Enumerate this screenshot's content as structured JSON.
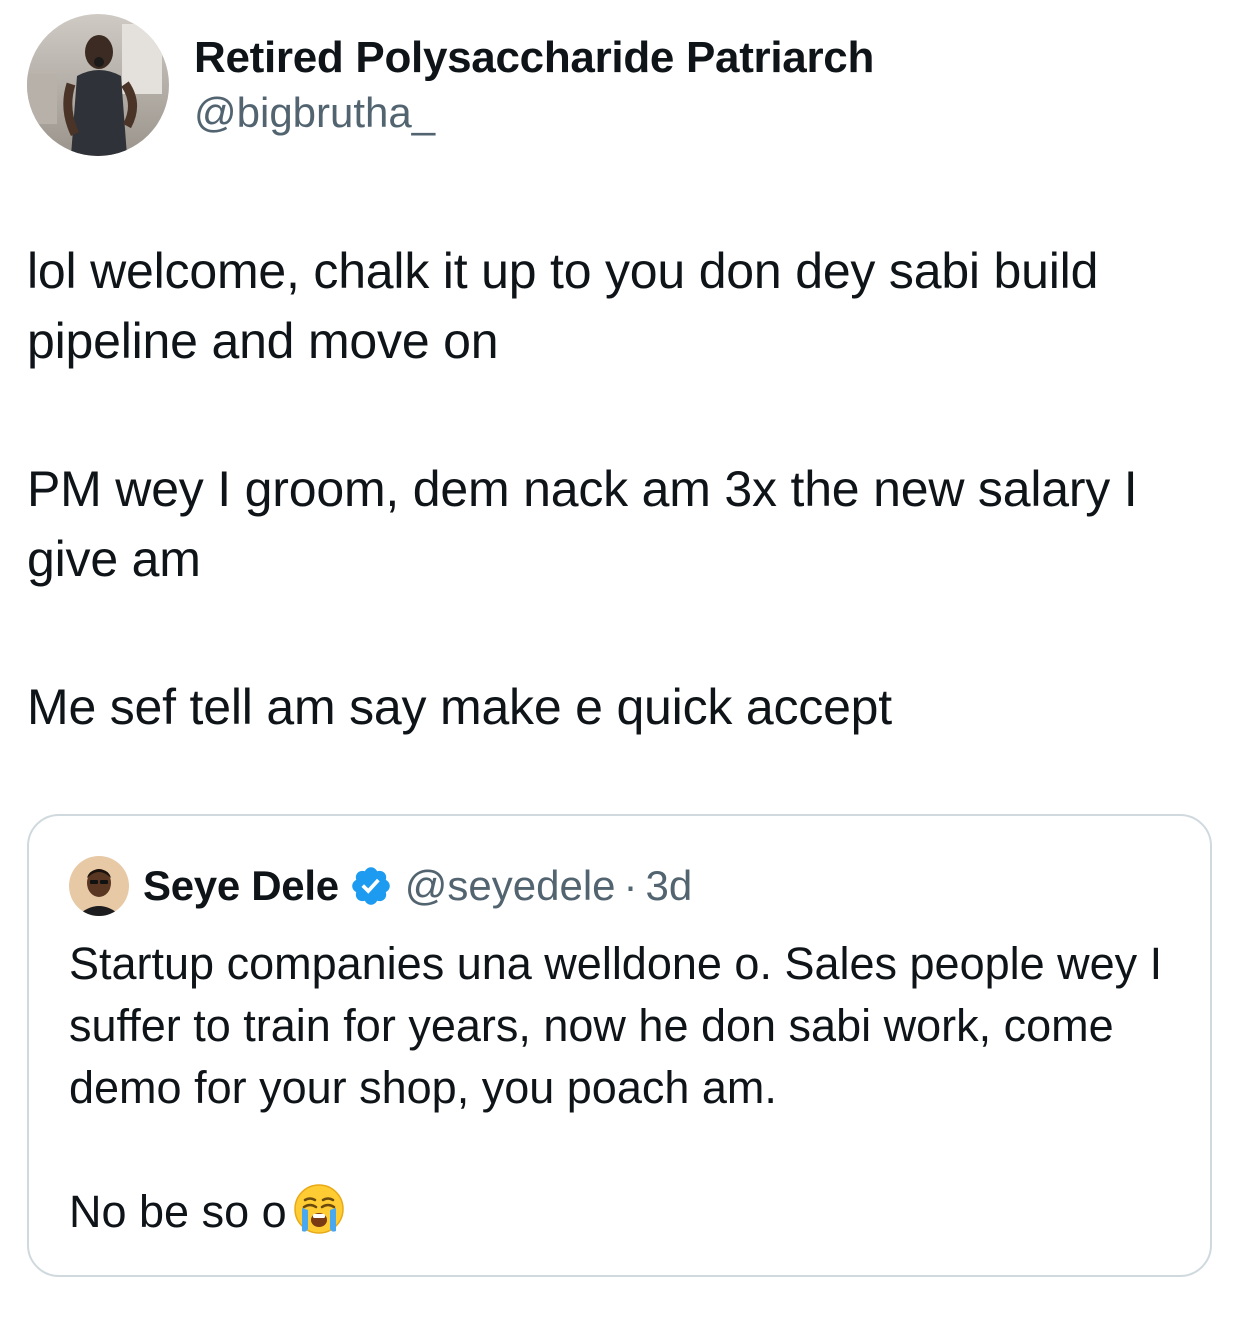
{
  "tweet": {
    "author": {
      "display_name": "Retired Polysaccharide Patriarch",
      "handle": "@bigbrutha_"
    },
    "paragraphs": [
      "lol welcome, chalk it up to you don dey sabi build pipeline and move on",
      "PM wey I groom, dem nack am 3x the new salary I give am",
      "Me sef tell am say make e quick accept"
    ]
  },
  "quoted_tweet": {
    "author": {
      "display_name": "Seye Dele",
      "handle": "@seyedele",
      "verified": true
    },
    "separator": "·",
    "time": "3d",
    "paragraphs": [
      "Startup companies una welldone o. Sales people wey I suffer to train for years, now he don sabi work, come demo for your shop, you poach am.",
      "No be so o"
    ],
    "emoji": "loudly-crying-face"
  },
  "colors": {
    "text_primary": "#0f1419",
    "text_secondary": "#536471",
    "border": "#cfd9de",
    "verified_blue": "#1d9bf0"
  }
}
